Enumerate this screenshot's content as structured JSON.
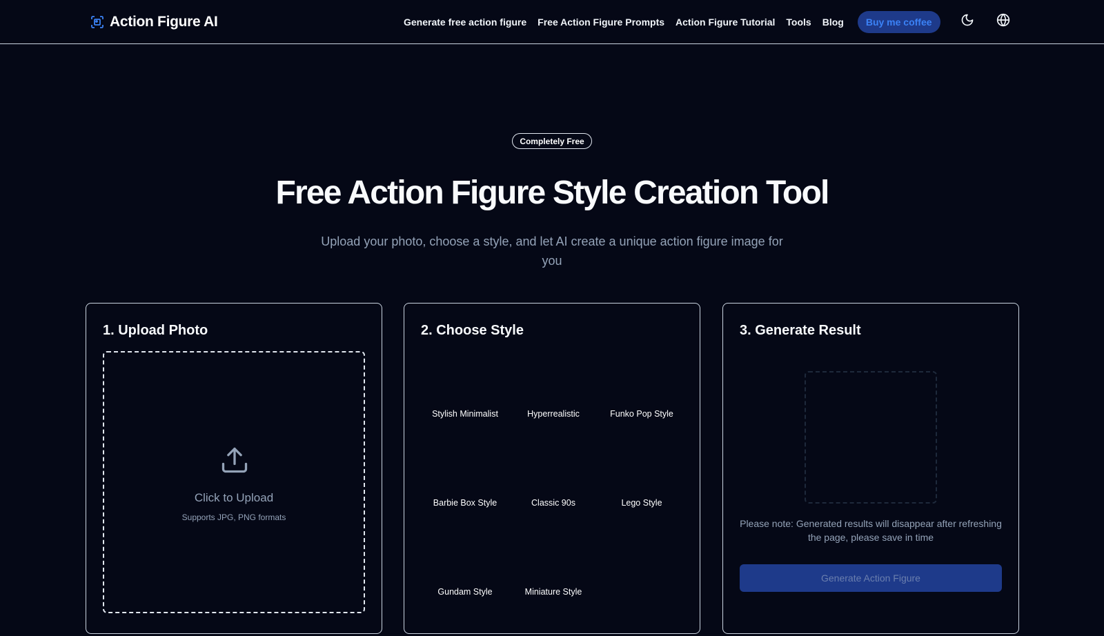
{
  "brand": {
    "name": "Action Figure AI",
    "icon": "scan-image-icon",
    "accent": "#3b82f6"
  },
  "nav": {
    "links": [
      "Generate free action figure",
      "Free Action Figure Prompts",
      "Action Figure Tutorial",
      "Tools",
      "Blog"
    ],
    "coffee_label": "Buy me coffee",
    "theme_icon": "moon-icon",
    "language_icon": "globe-icon"
  },
  "hero": {
    "badge": "Completely Free",
    "title": "Free Action Figure Style Creation Tool",
    "subtitle": "Upload your photo, choose a style, and let AI create a unique action figure image for you"
  },
  "upload": {
    "title": "1. Upload Photo",
    "label": "Click to Upload",
    "hint": "Supports JPG, PNG formats",
    "icon": "upload-icon"
  },
  "styles": {
    "title": "2. Choose Style",
    "options": [
      "Stylish Minimalist",
      "Hyperrealistic",
      "Funko Pop Style",
      "Barbie Box Style",
      "Classic 90s",
      "Lego Style",
      "Gundam Style",
      "Miniature Style"
    ]
  },
  "result": {
    "title": "3. Generate Result",
    "note": "Please note: Generated results will disappear after refreshing the page, please save in time",
    "button_label": "Generate Action Figure"
  },
  "colors": {
    "background": "#050816",
    "button": "#1e3a8a",
    "muted_text": "#94a3b8"
  }
}
